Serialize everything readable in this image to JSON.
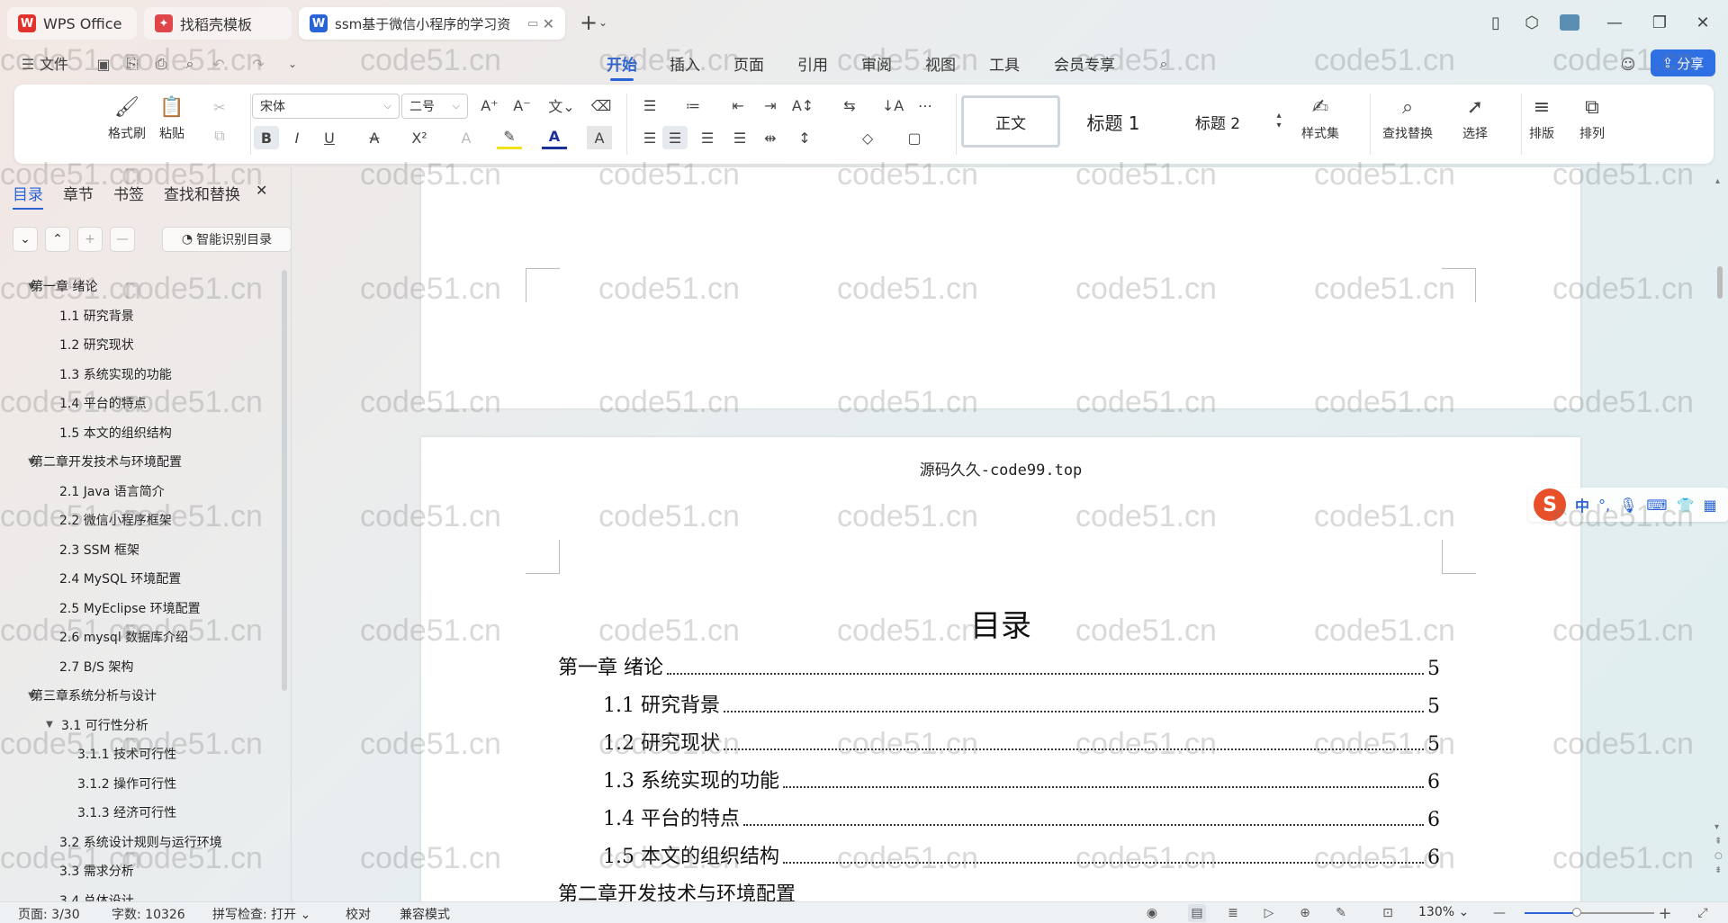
{
  "tabs": [
    {
      "label": "WPS Office",
      "icon": "wps-logo-icon"
    },
    {
      "label": "找稻壳模板",
      "icon": "docer-icon"
    },
    {
      "label": "ssm基于微信小程序的学习资",
      "icon": "word-doc-icon"
    }
  ],
  "menu": {
    "file": "文件",
    "items": [
      "开始",
      "插入",
      "页面",
      "引用",
      "审阅",
      "视图",
      "工具",
      "会员专享"
    ],
    "active": "开始",
    "share": "分享"
  },
  "ribbon": {
    "format_painter": "格式刷",
    "paste": "粘贴",
    "font_name": "宋体",
    "font_size": "二号",
    "styles": [
      "正文",
      "标题 1",
      "标题 2"
    ],
    "style_set": "样式集",
    "find_replace": "查找替换",
    "select": "选择",
    "layout": "排版",
    "arrange": "排列"
  },
  "nav": {
    "tabs": [
      "目录",
      "章节",
      "书签",
      "查找和替换"
    ],
    "active": "目录",
    "smart_toc": "智能识别目录",
    "items": [
      {
        "level": 1,
        "text": "第一章  绪论",
        "caret": "▼"
      },
      {
        "level": 2,
        "text": "1.1    研究背景"
      },
      {
        "level": 2,
        "text": "1.2    研究现状"
      },
      {
        "level": 2,
        "text": "1.3    系统实现的功能"
      },
      {
        "level": 2,
        "text": "1.4    平台的特点"
      },
      {
        "level": 2,
        "text": "1.5    本文的组织结构"
      },
      {
        "level": 1,
        "text": "第二章开发技术与环境配置",
        "caret": "▼"
      },
      {
        "level": 2,
        "text": "2.1    Java 语言简介"
      },
      {
        "level": 2,
        "text": "2.2    微信小程序框架"
      },
      {
        "level": 2,
        "text": "2.3    SSM 框架"
      },
      {
        "level": 2,
        "text": "2.4    MySQL 环境配置"
      },
      {
        "level": 2,
        "text": "2.5    MyEclipse 环境配置"
      },
      {
        "level": 2,
        "text": "2.6    mysql 数据库介绍"
      },
      {
        "level": 2,
        "text": "2.7    B/S 架构"
      },
      {
        "level": 1,
        "text": "第三章系统分析与设计",
        "caret": "▼"
      },
      {
        "level": 2,
        "text": "3.1  可行性分析",
        "caret": "▼"
      },
      {
        "level": 3,
        "text": "3.1.1 技术可行性"
      },
      {
        "level": 3,
        "text": "3.1.2 操作可行性"
      },
      {
        "level": 3,
        "text": "3.1.3 经济可行性"
      },
      {
        "level": 2,
        "text": "3.2    系统设计规则与运行环境"
      },
      {
        "level": 2,
        "text": "3.3    需求分析"
      },
      {
        "level": 2,
        "text": "3.4    总体设计"
      }
    ]
  },
  "document": {
    "header": "源码久久-code99.top",
    "title": "目录",
    "toc": [
      {
        "indent": 0,
        "label": "第一章  绪论",
        "page": "5"
      },
      {
        "indent": 1,
        "label": "1.1    研究背景",
        "page": "5"
      },
      {
        "indent": 1,
        "label": "1.2    研究现状",
        "page": "5"
      },
      {
        "indent": 1,
        "label": "1.3    系统实现的功能",
        "page": "6"
      },
      {
        "indent": 1,
        "label": "1.4    平台的特点",
        "page": "6"
      },
      {
        "indent": 1,
        "label": "1.5    本文的组织结构",
        "page": "6"
      },
      {
        "indent": 0,
        "label": "第二章开发技术与环境配置",
        "page": ""
      }
    ]
  },
  "ime": {
    "mode": "中",
    "punct": "°,"
  },
  "status": {
    "page": "页面: 3/30",
    "words": "字数: 10326",
    "spell": "拼写检查: 打开",
    "proof": "校对",
    "compat": "兼容模式",
    "zoom": "130%",
    "zoom_fraction": 0.4
  },
  "watermark": "code51.cn",
  "colors": {
    "accent": "#2a63d8",
    "share": "#2f6fe4",
    "ime": "#e8502a"
  }
}
